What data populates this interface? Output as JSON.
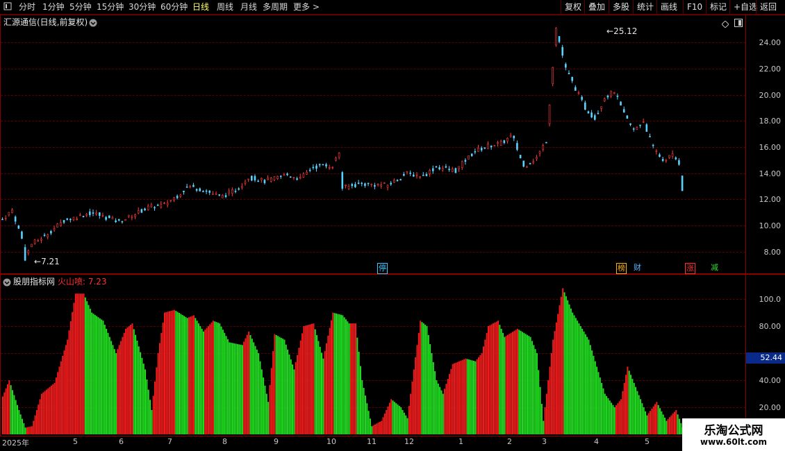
{
  "toolbar": {
    "items": [
      "分时",
      "1分钟",
      "5分钟",
      "15分钟",
      "30分钟",
      "60分钟",
      "日线",
      "周线",
      "月线",
      "多周期",
      "更多 >"
    ],
    "active": "日线",
    "right": [
      "复权",
      "叠加",
      "多股",
      "统计",
      "画线",
      "F10",
      "标记",
      "+自选",
      "返回"
    ]
  },
  "chart": {
    "title": "汇源通信(日线,前复权)",
    "price_ticks": [
      "24.00",
      "22.00",
      "20.00",
      "18.00",
      "16.00",
      "14.00",
      "12.00",
      "10.00",
      "8.00"
    ],
    "high_label": "25.12",
    "low_label": "7.21",
    "badges": [
      {
        "text": "停",
        "color": "#3cc8ff"
      },
      {
        "text": "榜",
        "color": "#ffb000"
      },
      {
        "text": "财",
        "color": "#5ab4ff"
      },
      {
        "text": "涨",
        "color": "#ff3030"
      },
      {
        "text": "减",
        "color": "#33dd33"
      }
    ]
  },
  "indicator": {
    "name": "股朋指标网",
    "label": "火山喷: 7.23",
    "ticks": [
      "100.0",
      "80.00",
      "60.00",
      "40.00",
      "20.00"
    ],
    "current_value": "52.44"
  },
  "xaxis": [
    "2025年",
    "5",
    "6",
    "7",
    "8",
    "9",
    "10",
    "11",
    "12",
    "1",
    "2",
    "3",
    "4",
    "5"
  ],
  "watermark": {
    "line1": "乐淘公式网",
    "line2": "www.60lt.com"
  },
  "chart_data": {
    "type": "candlestick",
    "title": "汇源通信(日线,前复权)",
    "price_axis_ticks": [
      8,
      10,
      12,
      14,
      16,
      18,
      20,
      22,
      24
    ],
    "price_high": 25.12,
    "price_low": 7.21,
    "close_path": [
      [
        0,
        10.5
      ],
      [
        6,
        11.2
      ],
      [
        12,
        9.0
      ],
      [
        14,
        7.5
      ],
      [
        18,
        8.6
      ],
      [
        26,
        9.2
      ],
      [
        38,
        10.4
      ],
      [
        55,
        11.0
      ],
      [
        72,
        10.3
      ],
      [
        90,
        11.4
      ],
      [
        100,
        11.6
      ],
      [
        108,
        12.3
      ],
      [
        115,
        13.0
      ],
      [
        125,
        12.7
      ],
      [
        135,
        12.2
      ],
      [
        145,
        12.8
      ],
      [
        152,
        13.7
      ],
      [
        162,
        13.4
      ],
      [
        176,
        13.9
      ],
      [
        184,
        13.6
      ],
      [
        192,
        14.5
      ],
      [
        204,
        14.6
      ],
      [
        208,
        15.6
      ],
      [
        210,
        12.9
      ],
      [
        222,
        13.2
      ],
      [
        238,
        13.1
      ],
      [
        250,
        14.0
      ],
      [
        260,
        13.8
      ],
      [
        268,
        14.5
      ],
      [
        280,
        14.2
      ],
      [
        286,
        15.0
      ],
      [
        292,
        15.7
      ],
      [
        300,
        16.1
      ],
      [
        308,
        16.3
      ],
      [
        315,
        16.9
      ],
      [
        322,
        14.5
      ],
      [
        330,
        15.2
      ],
      [
        336,
        16.5
      ],
      [
        342,
        25.1
      ],
      [
        348,
        22.0
      ],
      [
        354,
        20.5
      ],
      [
        360,
        19.0
      ],
      [
        366,
        18.2
      ],
      [
        372,
        19.8
      ],
      [
        378,
        20.3
      ],
      [
        384,
        18.5
      ],
      [
        390,
        17.3
      ],
      [
        396,
        18.0
      ],
      [
        402,
        16.0
      ],
      [
        408,
        15.0
      ],
      [
        414,
        15.4
      ],
      [
        418,
        14.8
      ],
      [
        420,
        12.8
      ]
    ],
    "indicator": {
      "name": "火山喷",
      "current": 7.23,
      "axis_ticks": [
        20,
        40,
        60,
        80,
        100
      ],
      "series": [
        [
          0,
          28
        ],
        [
          4,
          40
        ],
        [
          10,
          18
        ],
        [
          14,
          5
        ],
        [
          18,
          6
        ],
        [
          24,
          30
        ],
        [
          32,
          38
        ],
        [
          40,
          70
        ],
        [
          45,
          104
        ],
        [
          50,
          104
        ],
        [
          55,
          90
        ],
        [
          62,
          84
        ],
        [
          70,
          60
        ],
        [
          76,
          78
        ],
        [
          80,
          82
        ],
        [
          88,
          48
        ],
        [
          92,
          18
        ],
        [
          96,
          60
        ],
        [
          100,
          90
        ],
        [
          106,
          92
        ],
        [
          114,
          86
        ],
        [
          118,
          88
        ],
        [
          124,
          76
        ],
        [
          130,
          84
        ],
        [
          134,
          82
        ],
        [
          140,
          68
        ],
        [
          148,
          66
        ],
        [
          152,
          76
        ],
        [
          158,
          60
        ],
        [
          164,
          24
        ],
        [
          168,
          74
        ],
        [
          174,
          70
        ],
        [
          180,
          48
        ],
        [
          186,
          80
        ],
        [
          192,
          82
        ],
        [
          198,
          56
        ],
        [
          204,
          90
        ],
        [
          210,
          88
        ],
        [
          214,
          82
        ],
        [
          218,
          82
        ],
        [
          222,
          40
        ],
        [
          228,
          6
        ],
        [
          234,
          10
        ],
        [
          240,
          26
        ],
        [
          246,
          20
        ],
        [
          250,
          12
        ],
        [
          258,
          84
        ],
        [
          262,
          80
        ],
        [
          268,
          40
        ],
        [
          272,
          30
        ],
        [
          278,
          52
        ],
        [
          286,
          56
        ],
        [
          292,
          54
        ],
        [
          296,
          60
        ],
        [
          300,
          80
        ],
        [
          306,
          84
        ],
        [
          310,
          72
        ],
        [
          318,
          78
        ],
        [
          326,
          72
        ],
        [
          330,
          60
        ],
        [
          334,
          10
        ],
        [
          340,
          70
        ],
        [
          346,
          108
        ],
        [
          352,
          90
        ],
        [
          362,
          70
        ],
        [
          372,
          30
        ],
        [
          378,
          20
        ],
        [
          382,
          26
        ],
        [
          386,
          50
        ],
        [
          392,
          32
        ],
        [
          398,
          14
        ],
        [
          404,
          24
        ],
        [
          410,
          10
        ],
        [
          416,
          18
        ],
        [
          420,
          5
        ]
      ]
    }
  }
}
